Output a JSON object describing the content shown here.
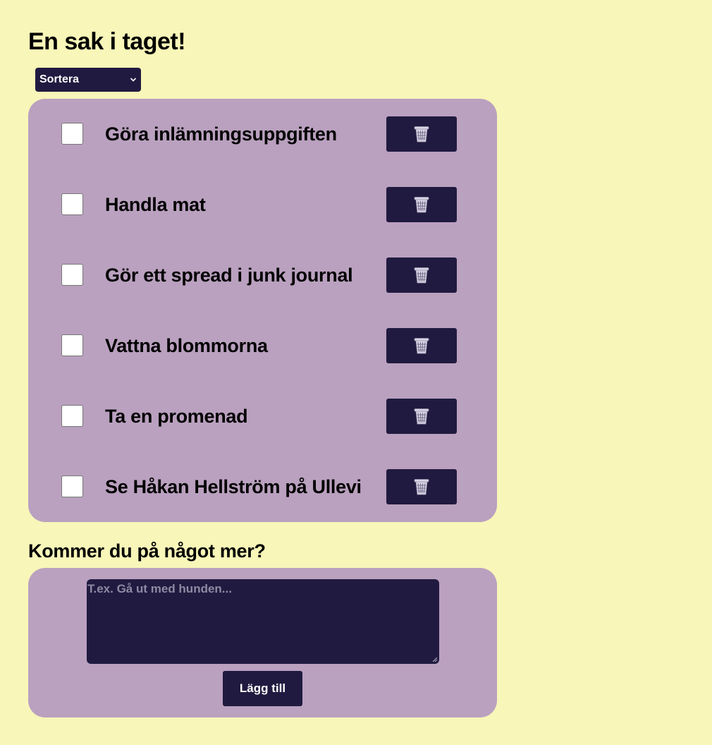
{
  "header": {
    "title": "En sak i taget!"
  },
  "sort": {
    "selected": "Sortera",
    "icon": "chevron-down-icon"
  },
  "todos": [
    {
      "label": "Göra inlämningsuppgiften",
      "checked": false
    },
    {
      "label": "Handla mat",
      "checked": false
    },
    {
      "label": "Gör ett spread i junk journal",
      "checked": false
    },
    {
      "label": "Vattna blommorna",
      "checked": false
    },
    {
      "label": "Ta en promenad",
      "checked": false
    },
    {
      "label": "Se Håkan Hellström på Ullevi",
      "checked": false
    }
  ],
  "delete_icon": "trash-icon",
  "add_section": {
    "title": "Kommer du på något mer?",
    "placeholder": "T.ex. Gå ut med hunden...",
    "button_label": "Lägg till"
  },
  "colors": {
    "background": "#f8f6b8",
    "panel": "#baa1bf",
    "dark": "#211a40"
  }
}
